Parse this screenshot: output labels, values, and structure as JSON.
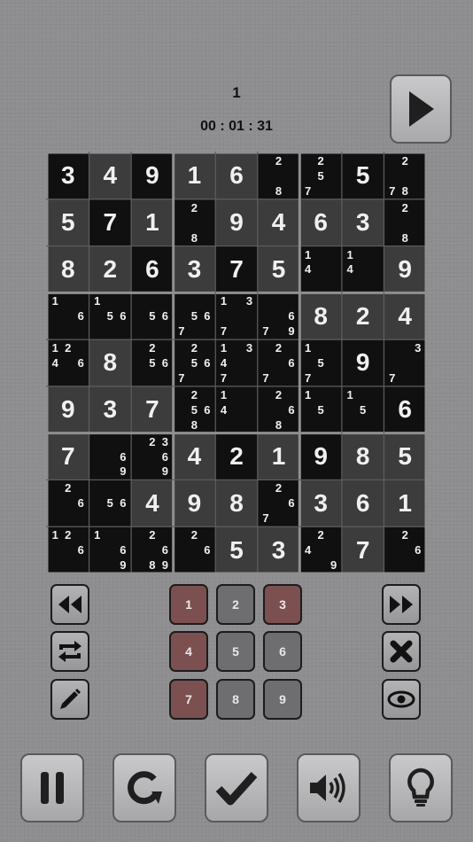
{
  "header": {
    "level": "1",
    "timer": "00 : 01 : 31"
  },
  "icons": {
    "play": "play-icon",
    "rewind": "rewind-icon",
    "fast_forward": "fast-forward-icon",
    "swap": "repeat-icon",
    "erase": "close-icon",
    "pencil": "pencil-icon",
    "eye": "eye-icon",
    "pause": "pause-icon",
    "restart": "refresh-icon",
    "check": "check-icon",
    "sound": "speaker-icon",
    "hint": "lightbulb-icon"
  },
  "colors": {
    "background": "#8e8e90",
    "cell_dark": "#101010",
    "cell_light": "#3c3c3c",
    "active_number": "#7c5050",
    "number_button": "#6e6e70"
  },
  "board": {
    "values": [
      [
        3,
        4,
        9,
        1,
        6,
        0,
        0,
        5,
        0
      ],
      [
        5,
        7,
        1,
        0,
        9,
        4,
        6,
        3,
        0
      ],
      [
        8,
        2,
        6,
        3,
        7,
        5,
        0,
        0,
        9
      ],
      [
        0,
        0,
        0,
        0,
        0,
        0,
        8,
        2,
        4
      ],
      [
        0,
        8,
        0,
        0,
        0,
        0,
        0,
        9,
        0
      ],
      [
        9,
        3,
        7,
        0,
        0,
        0,
        0,
        0,
        6
      ],
      [
        7,
        0,
        0,
        4,
        2,
        1,
        9,
        8,
        5
      ],
      [
        0,
        0,
        4,
        9,
        8,
        0,
        3,
        6,
        1
      ],
      [
        0,
        0,
        0,
        0,
        5,
        3,
        0,
        7,
        0
      ]
    ],
    "shade": [
      [
        "d",
        "l",
        "d",
        "l",
        "l",
        "d",
        "d",
        "d",
        "d"
      ],
      [
        "l",
        "d",
        "l",
        "d",
        "l",
        "l",
        "l",
        "l",
        "d"
      ],
      [
        "l",
        "l",
        "d",
        "l",
        "d",
        "l",
        "d",
        "d",
        "l"
      ],
      [
        "d",
        "d",
        "d",
        "d",
        "d",
        "d",
        "l",
        "l",
        "l"
      ],
      [
        "d",
        "l",
        "d",
        "d",
        "d",
        "d",
        "d",
        "d",
        "d"
      ],
      [
        "l",
        "l",
        "l",
        "d",
        "d",
        "d",
        "d",
        "d",
        "d"
      ],
      [
        "l",
        "d",
        "d",
        "l",
        "d",
        "l",
        "d",
        "l",
        "l"
      ],
      [
        "d",
        "d",
        "l",
        "l",
        "l",
        "d",
        "l",
        "l",
        "l"
      ],
      [
        "d",
        "d",
        "d",
        "d",
        "l",
        "l",
        "d",
        "l",
        "d"
      ]
    ],
    "notes": [
      [
        [],
        [],
        [],
        [],
        [],
        [
          8,
          2
        ],
        [
          7,
          5,
          2
        ],
        [],
        [
          7,
          8,
          2
        ]
      ],
      [
        [],
        [],
        [],
        [
          8,
          2
        ],
        [],
        [],
        [],
        [],
        [
          8,
          2
        ]
      ],
      [
        [],
        [],
        [],
        [],
        [],
        [],
        [
          4,
          1
        ],
        [
          4,
          1
        ],
        []
      ],
      [
        [
          6,
          1
        ],
        [
          5,
          6,
          1
        ],
        [
          5,
          6
        ],
        [
          7,
          5,
          6
        ],
        [
          7,
          1,
          3
        ],
        [
          7,
          9,
          6
        ],
        [],
        [],
        []
      ],
      [
        [
          4,
          6,
          1,
          2
        ],
        [],
        [
          5,
          6,
          2
        ],
        [
          7,
          5,
          6,
          2
        ],
        [
          7,
          4,
          1,
          3
        ],
        [
          7,
          6,
          2
        ],
        [
          7,
          5,
          1
        ],
        [],
        [
          7,
          3
        ]
      ],
      [
        [],
        [],
        [],
        [
          8,
          5,
          6,
          2
        ],
        [
          4,
          1
        ],
        [
          8,
          6,
          2
        ],
        [
          5,
          1
        ],
        [
          5,
          1
        ],
        []
      ],
      [
        [],
        [
          9,
          6
        ],
        [
          9,
          6,
          2,
          3
        ],
        [],
        [],
        [],
        [],
        [],
        []
      ],
      [
        [
          6,
          2
        ],
        [
          5,
          6
        ],
        [],
        [],
        [],
        [
          7,
          6,
          2
        ],
        [],
        [],
        []
      ],
      [
        [
          6,
          1,
          2
        ],
        [
          9,
          6,
          1
        ],
        [
          8,
          9,
          6,
          2
        ],
        [
          6,
          2
        ],
        [],
        [],
        [
          9,
          4,
          2
        ],
        [],
        [
          6,
          2
        ]
      ]
    ]
  },
  "numpad": [
    {
      "label": "1",
      "active": true
    },
    {
      "label": "2",
      "active": false
    },
    {
      "label": "3",
      "active": true
    },
    {
      "label": "4",
      "active": true
    },
    {
      "label": "5",
      "active": false
    },
    {
      "label": "6",
      "active": false
    },
    {
      "label": "7",
      "active": true
    },
    {
      "label": "8",
      "active": false
    },
    {
      "label": "9",
      "active": false
    }
  ]
}
